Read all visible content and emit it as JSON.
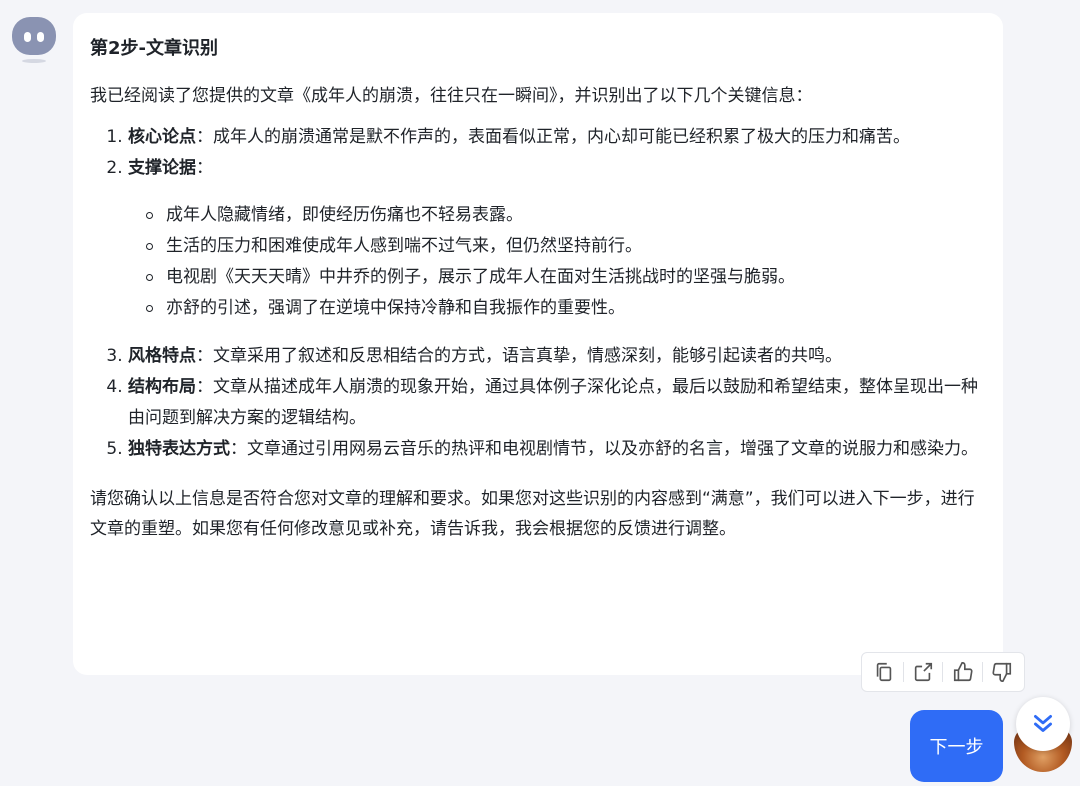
{
  "bot": {
    "avatar_icon": "robot-avatar-icon"
  },
  "message": {
    "title": "第2步-文章识别",
    "intro": "我已经阅读了您提供的文章《成年人的崩溃，往往只在一瞬间》，并识别出了以下几个关键信息：",
    "points": [
      {
        "label": "核心论点",
        "text": "：成年人的崩溃通常是默不作声的，表面看似正常，内心却可能已经积累了极大的压力和痛苦。"
      },
      {
        "label": "支撑论据",
        "text": "："
      },
      {
        "label": "风格特点",
        "text": "：文章采用了叙述和反思相结合的方式，语言真挚，情感深刻，能够引起读者的共鸣。"
      },
      {
        "label": "结构布局",
        "text": "：文章从描述成年人崩溃的现象开始，通过具体例子深化论点，最后以鼓励和希望结束，整体呈现出一种由问题到解决方案的逻辑结构。"
      },
      {
        "label": "独特表达方式",
        "text": "：文章通过引用网易云音乐的热评和电视剧情节，以及亦舒的名言，增强了文章的说服力和感染力。"
      }
    ],
    "sub_points": [
      "成年人隐藏情绪，即使经历伤痛也不轻易表露。",
      "生活的压力和困难使成年人感到喘不过气来，但仍然坚持前行。",
      "电视剧《天天天晴》中井乔的例子，展示了成年人在面对生活挑战时的坚强与脆弱。",
      "亦舒的引述，强调了在逆境中保持冷静和自我振作的重要性。"
    ],
    "closing": "请您确认以上信息是否符合您对文章的理解和要求。如果您对这些识别的内容感到“满意”，我们可以进入下一步，进行文章的重塑。如果您有任何修改意见或补充，请告诉我，我会根据您的反馈进行调整。"
  },
  "toolbar": {
    "icons": [
      "copy-icon",
      "share-icon",
      "thumbs-up-icon",
      "thumbs-down-icon"
    ]
  },
  "next_button": {
    "label": "下一步"
  },
  "colors": {
    "accent": "#2f6cf6",
    "page_bg": "#f4f5f9",
    "card_bg": "#ffffff"
  }
}
